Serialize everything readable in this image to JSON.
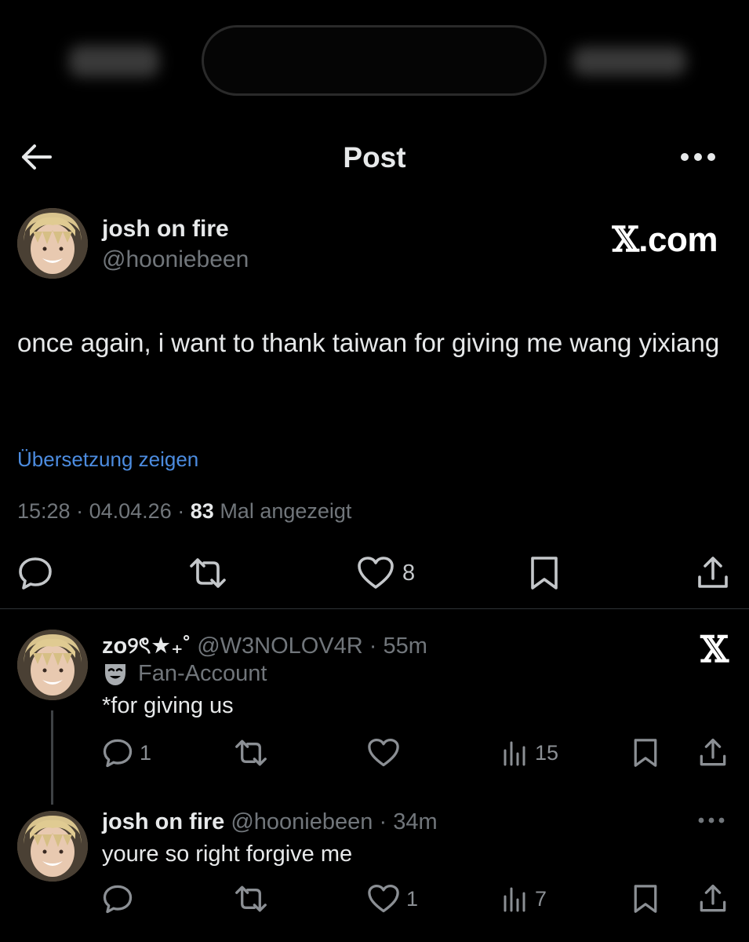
{
  "header": {
    "title": "Post"
  },
  "post": {
    "author_name": "josh on fire",
    "author_handle": "@hooniebeen",
    "watermark_x": "𝕏",
    "watermark_suffix": ".com",
    "text": "once again, i want to thank taiwan for giving me wang yixiang",
    "translate_label": "Übersetzung zeigen",
    "time": "15:28",
    "date": "04.04.26",
    "views_count": "83",
    "views_label": "Mal angezeigt",
    "separator": "·",
    "likes": "8"
  },
  "replies": [
    {
      "name": "zo୨ৎ★₊˚",
      "handle": "@W3NOLOV4R",
      "age": "55m",
      "badge_label": "Fan-Account",
      "text": "*for giving us",
      "replies_count": "1",
      "likes": "",
      "views": "15",
      "logo": "𝕏"
    },
    {
      "name": "josh on fire",
      "handle": "@hooniebeen",
      "age": "34m",
      "text": "youre so right forgive me",
      "replies_count": "",
      "likes": "1",
      "views": "7"
    }
  ],
  "icons": {
    "back": "arrow-left-icon",
    "more": "more-horizontal-icon",
    "reply": "speech-bubble-icon",
    "repost": "repost-icon",
    "like": "heart-icon",
    "bookmark": "bookmark-icon",
    "share": "share-icon",
    "views": "bar-chart-icon",
    "badge": "theater-mask-icon"
  },
  "colors": {
    "background": "#000000",
    "text": "#e7e9ea",
    "muted": "#71767b",
    "link": "#4c8ce0"
  }
}
